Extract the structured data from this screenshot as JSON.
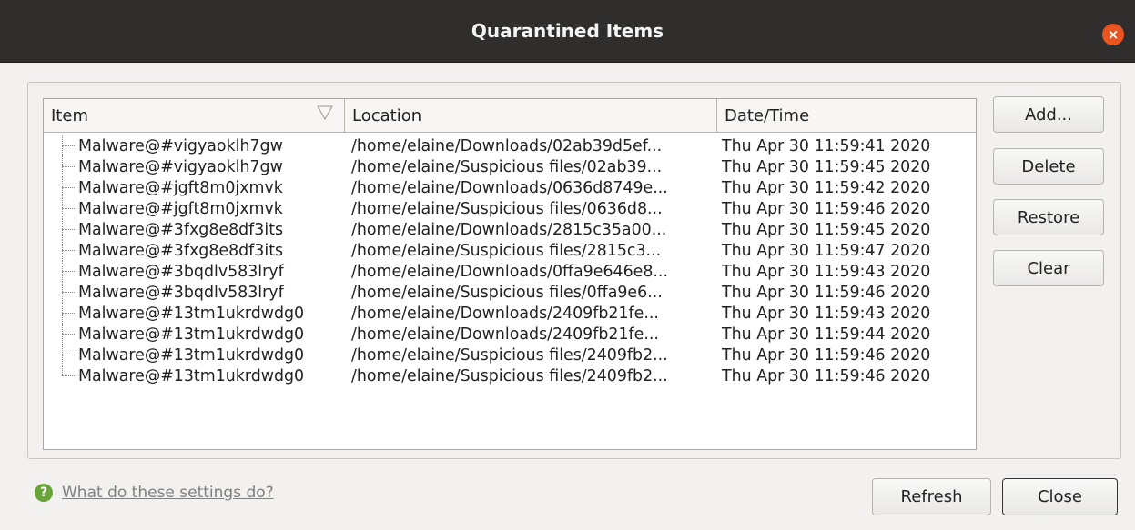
{
  "window": {
    "title": "Quarantined Items",
    "close_glyph": "×"
  },
  "table": {
    "columns": [
      "Item",
      "Location",
      "Date/Time"
    ],
    "rows": [
      {
        "item": "Malware@#vigyaoklh7gw",
        "location": "/home/elaine/Downloads/02ab39d5ef...",
        "datetime": "Thu Apr 30 11:59:41 2020"
      },
      {
        "item": "Malware@#vigyaoklh7gw",
        "location": "/home/elaine/Suspicious files/02ab39...",
        "datetime": "Thu Apr 30 11:59:45 2020"
      },
      {
        "item": "Malware@#jgft8m0jxmvk",
        "location": "/home/elaine/Downloads/0636d8749e...",
        "datetime": "Thu Apr 30 11:59:42 2020"
      },
      {
        "item": "Malware@#jgft8m0jxmvk",
        "location": "/home/elaine/Suspicious files/0636d8...",
        "datetime": "Thu Apr 30 11:59:46 2020"
      },
      {
        "item": "Malware@#3fxg8e8df3its",
        "location": "/home/elaine/Downloads/2815c35a00...",
        "datetime": "Thu Apr 30 11:59:45 2020"
      },
      {
        "item": "Malware@#3fxg8e8df3its",
        "location": "/home/elaine/Suspicious files/2815c3...",
        "datetime": "Thu Apr 30 11:59:47 2020"
      },
      {
        "item": "Malware@#3bqdlv583lryf",
        "location": "/home/elaine/Downloads/0ffa9e646e8...",
        "datetime": "Thu Apr 30 11:59:43 2020"
      },
      {
        "item": "Malware@#3bqdlv583lryf",
        "location": "/home/elaine/Suspicious files/0ffa9e6...",
        "datetime": "Thu Apr 30 11:59:46 2020"
      },
      {
        "item": "Malware@#13tm1ukrdwdg0",
        "location": "/home/elaine/Downloads/2409fb21fe...",
        "datetime": "Thu Apr 30 11:59:43 2020"
      },
      {
        "item": "Malware@#13tm1ukrdwdg0",
        "location": "/home/elaine/Downloads/2409fb21fe...",
        "datetime": "Thu Apr 30 11:59:44 2020"
      },
      {
        "item": "Malware@#13tm1ukrdwdg0",
        "location": "/home/elaine/Suspicious files/2409fb2...",
        "datetime": "Thu Apr 30 11:59:46 2020"
      },
      {
        "item": "Malware@#13tm1ukrdwdg0",
        "location": "/home/elaine/Suspicious files/2409fb2...",
        "datetime": "Thu Apr 30 11:59:46 2020"
      }
    ]
  },
  "side_buttons": {
    "add": "Add...",
    "delete": "Delete",
    "restore": "Restore",
    "clear": "Clear"
  },
  "footer": {
    "help_icon": "?",
    "help_text": "What do these settings do?",
    "refresh": "Refresh",
    "close": "Close"
  }
}
